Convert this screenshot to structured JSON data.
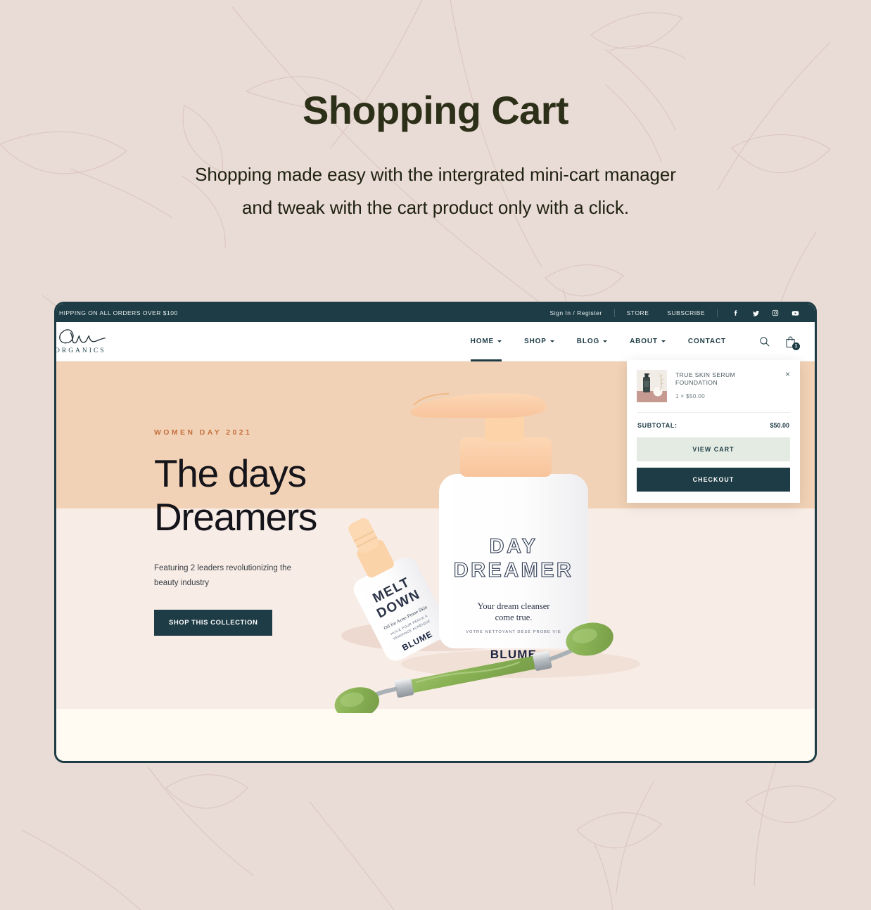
{
  "page": {
    "title": "Shopping Cart",
    "subtitle_line1": "Shopping  made easy with the intergrated mini-cart manager",
    "subtitle_line2": "and tweak with the cart product only with a click.",
    "background_color": "#e9dbd5",
    "title_color": "#2d3018"
  },
  "browser": {
    "frame_color": "#1e3c45"
  },
  "topbar": {
    "announcement": "HIPPING ON ALL ORDERS OVER $100",
    "sign_in": "Sign In / Register",
    "store": "STORE",
    "subscribe": "SUBSCRIBE",
    "social": [
      {
        "name": "facebook-icon",
        "label": "Facebook"
      },
      {
        "name": "twitter-icon",
        "label": "Twitter"
      },
      {
        "name": "instagram-icon",
        "label": "Instagram"
      },
      {
        "name": "youtube-icon",
        "label": "YouTube"
      }
    ],
    "background_color": "#1e3c45"
  },
  "brand": {
    "wordmark": "ORGANICS"
  },
  "nav": {
    "items": [
      {
        "label": "HOME",
        "has_dropdown": true,
        "active": true
      },
      {
        "label": "SHOP",
        "has_dropdown": true,
        "active": false
      },
      {
        "label": "BLOG",
        "has_dropdown": true,
        "active": false
      },
      {
        "label": "ABOUT",
        "has_dropdown": true,
        "active": false
      },
      {
        "label": "CONTACT",
        "has_dropdown": false,
        "active": false
      }
    ],
    "search_icon": "search-icon",
    "cart_icon": "shopping-bag-icon",
    "cart_count": "1"
  },
  "hero": {
    "eyebrow": "WOMEN DAY 2021",
    "title_line1": "The days",
    "title_line2": "Dreamers",
    "subtitle": "Featuring 2 leaders revolutionizing the beauty industry",
    "button": "SHOP THIS COLLECTION",
    "band_1_color": "#f2d2b6",
    "band_2_color": "#f8ece6",
    "band_3_color": "#fffaf2",
    "eyebrow_color": "#c4703f",
    "products": [
      {
        "name": "DAY DREAMER",
        "tagline_line1": "Your dream cleanser",
        "tagline_line2": "come true.",
        "tagline_fr": "VOTRE NETTOYANT DÉSÉ PROBE VIE",
        "brand": "BLUME"
      },
      {
        "name_line1": "MELT",
        "name_line2": "DOWN",
        "desc_line1": "Oil for Acne-Prone Skin",
        "desc_line2": "HUILE POUR PEAUX À",
        "desc_line3": "TENDANCE ACNÉIQUE",
        "brand": "BLUME"
      }
    ]
  },
  "mini_cart": {
    "item_name": "TRUE SKIN SERUM FOUNDATION",
    "item_qty": "1 × $50.00",
    "close_label": "×",
    "subtotal_label": "SUBTOTAL:",
    "subtotal_value": "$50.00",
    "view_cart_label": "VIEW CART",
    "checkout_label": "CHECKOUT",
    "view_cart_color": "#e3ebe3",
    "checkout_color": "#1e3c45"
  }
}
